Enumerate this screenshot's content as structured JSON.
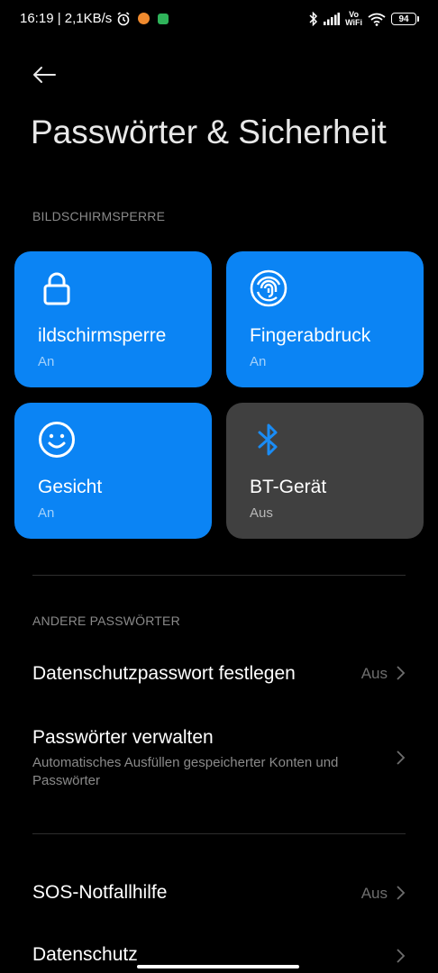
{
  "status_bar": {
    "time_speed": "16:19 | 2,1KB/s",
    "vowifi_top": "Vo",
    "vowifi_bottom": "WiFi",
    "battery": "94"
  },
  "header": {
    "title": "Passwörter & Sicherheit"
  },
  "sections": {
    "lock_screen": "BILDSCHIRMSPERRE",
    "other_passwords": "ANDERE PASSWÖRTER"
  },
  "tiles": [
    {
      "label": "ildschirmsperre",
      "status": "An",
      "icon": "lock-icon",
      "color": "#0b84f4"
    },
    {
      "label": "Fingerabdruck",
      "status": "An",
      "icon": "fingerprint-icon",
      "color": "#0b84f4"
    },
    {
      "label": "Gesicht",
      "status": "An",
      "icon": "face-icon",
      "color": "#0b84f4"
    },
    {
      "label": "BT-Gerät",
      "status": "Aus",
      "icon": "bluetooth-icon",
      "color": "#404040"
    }
  ],
  "rows": [
    {
      "title": "Datenschutzpasswort festlegen",
      "value": "Aus"
    },
    {
      "title": "Passwörter verwalten",
      "subtitle": "Automatisches Ausfüllen gespeicherter Konten und Passwörter"
    },
    {
      "title": "SOS-Notfallhilfe",
      "value": "Aus"
    },
    {
      "title": "Datenschutz"
    }
  ],
  "colors": {
    "accent": "#0b84f4",
    "background": "#000000",
    "tile_inactive": "#404040",
    "secondary_text": "#8a8a8a"
  }
}
